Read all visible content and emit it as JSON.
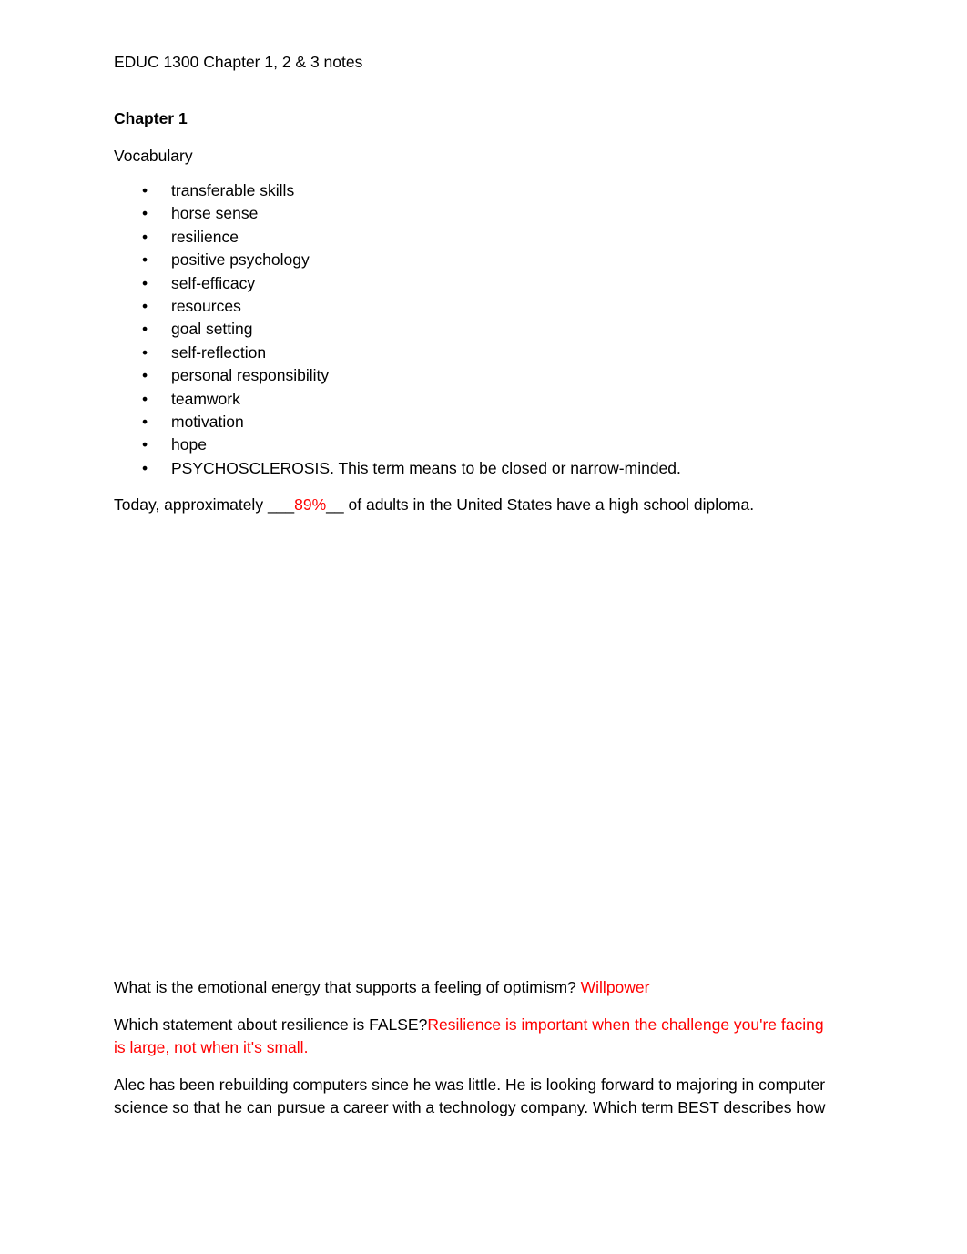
{
  "document": {
    "title": "EDUC 1300 Chapter 1, 2 & 3 notes",
    "accent_red": "#FF0000",
    "chapter_heading": "Chapter 1",
    "section_label": "Vocabulary",
    "vocabulary": [
      "transferable skills",
      "horse sense",
      "resilience",
      "positive psychology",
      "self-efficacy",
      "resources",
      "goal setting",
      "self-reflection",
      "personal responsibility",
      "teamwork",
      "motivation",
      "hope",
      "PSYCHOSCLEROSIS. This term means to be closed or narrow-minded."
    ],
    "fill_in_statement": {
      "before": "Today, approximately ",
      "leading_underscores": "___",
      "answer": "89%",
      "trailing_underscores": "__",
      "after": " of adults in the United States have a high school diploma."
    },
    "questions": [
      {
        "prompt": "What is the emotional energy that supports a feeling of optimism? ",
        "answer": "Willpower"
      },
      {
        "prompt": "Which statement about resilience is FALSE?",
        "answer": "Resilience is important when the challenge you're facing is large, not when it's small."
      }
    ],
    "trailing_paragraph": "Alec has been rebuilding computers since he was little. He is looking forward to majoring in computer science so that he can pursue a career with a technology company. Which term BEST describes how"
  }
}
